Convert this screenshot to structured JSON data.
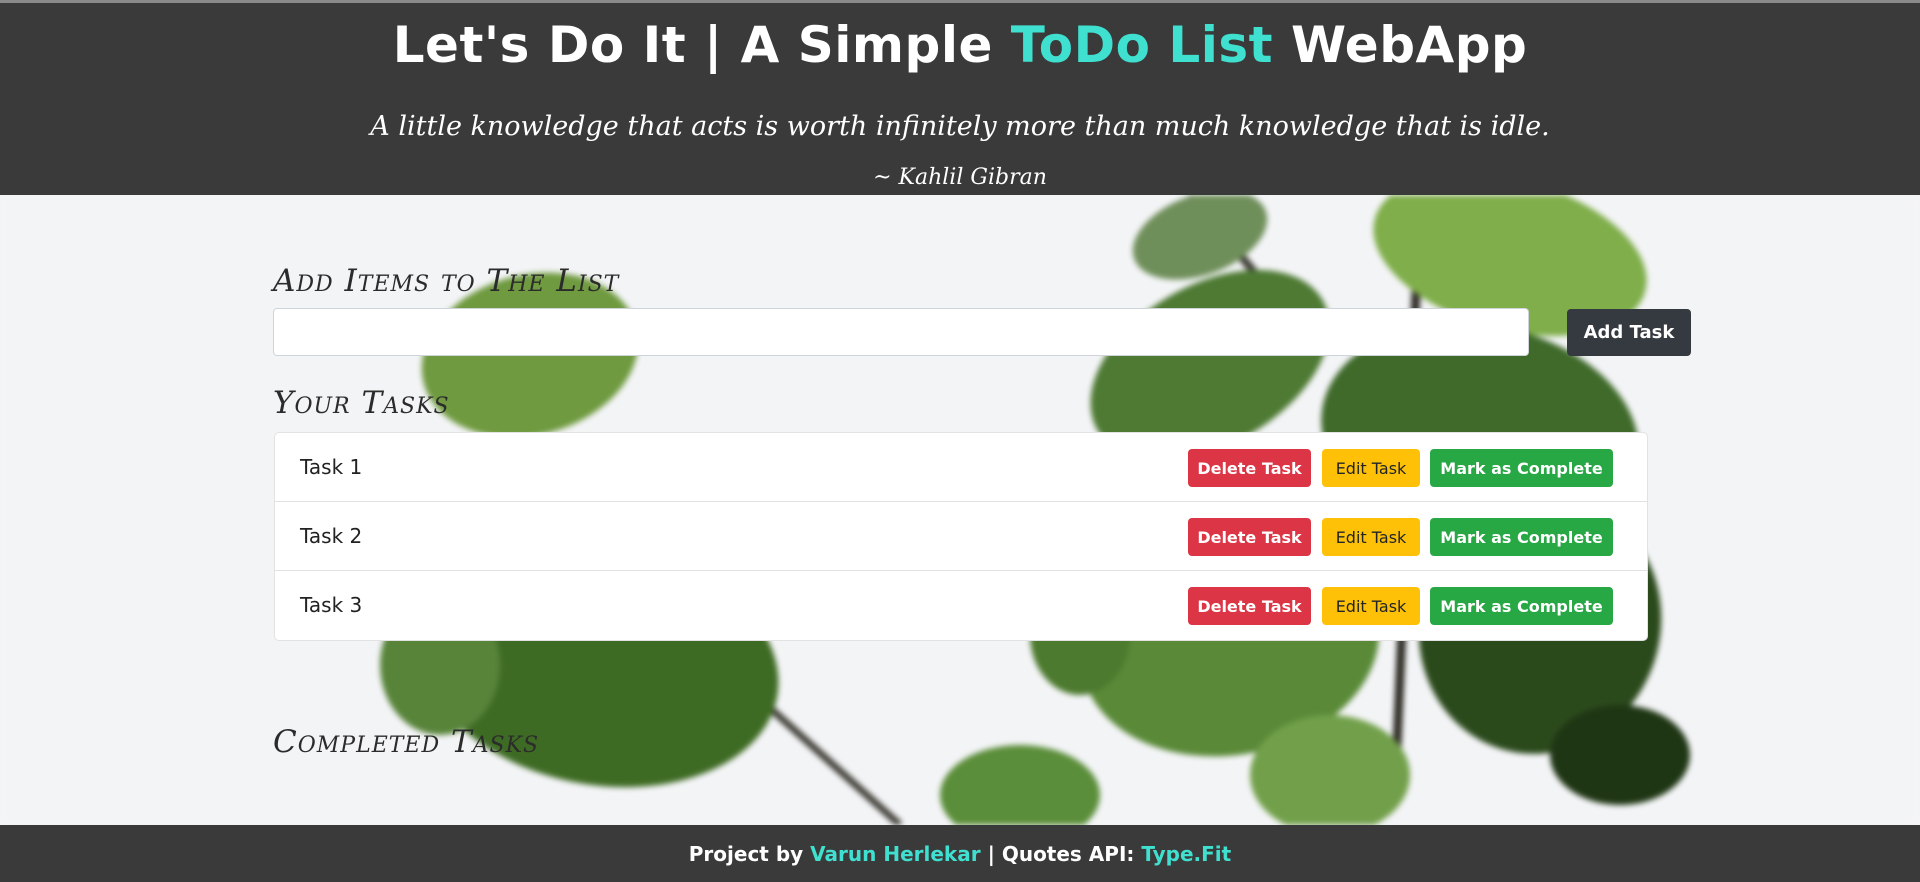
{
  "header": {
    "title_part1": "Let's Do It | A Simple ",
    "title_accent": "ToDo List",
    "title_part2": " WebApp",
    "quote": "A little knowledge that acts is worth infinitely more than much knowledge that is idle.",
    "author": "~ Kahlil Gibran"
  },
  "add_section": {
    "heading": "Add Items to The List",
    "input_value": "",
    "add_button": "Add Task"
  },
  "tasks_section": {
    "heading": "Your Tasks",
    "tasks": [
      {
        "name": "Task 1",
        "delete": "Delete Task",
        "edit": "Edit Task",
        "complete": "Mark as Complete"
      },
      {
        "name": "Task 2",
        "delete": "Delete Task",
        "edit": "Edit Task",
        "complete": "Mark as Complete"
      },
      {
        "name": "Task 3",
        "delete": "Delete Task",
        "edit": "Edit Task",
        "complete": "Mark as Complete"
      }
    ]
  },
  "completed_section": {
    "heading": "Completed Tasks"
  },
  "footer": {
    "prefix": "Project by ",
    "author_link": "Varun Herlekar",
    "middle": " | Quotes API: ",
    "api_link": "Type.Fit"
  },
  "colors": {
    "header_bg": "#3a3a3a",
    "accent": "#40e0d0",
    "delete": "#dc3545",
    "edit": "#ffc107",
    "complete": "#28a745",
    "add_button": "#343a40"
  }
}
